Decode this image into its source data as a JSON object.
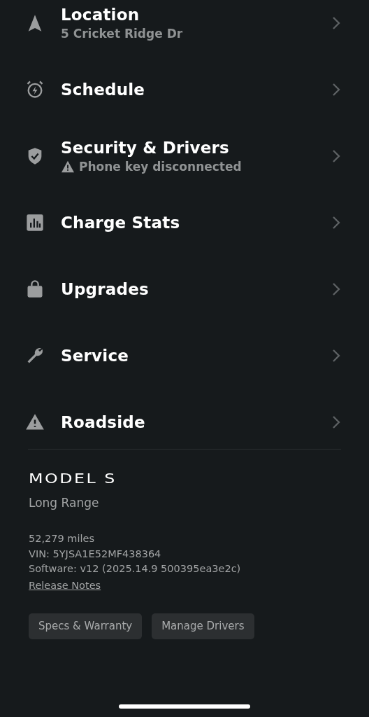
{
  "menu": [
    {
      "title": "Location",
      "subtitle": "5 Cricket Ridge Dr",
      "warning": false
    },
    {
      "title": "Schedule"
    },
    {
      "title": "Security & Drivers",
      "subtitle": "Phone key disconnected",
      "warning": true
    },
    {
      "title": "Charge Stats"
    },
    {
      "title": "Upgrades"
    },
    {
      "title": "Service"
    },
    {
      "title": "Roadside"
    }
  ],
  "vehicle": {
    "model": "MODEL S",
    "trim": "Long Range",
    "details": [
      "52,279 miles",
      "VIN: 5YJSA1E52MF438364",
      "Software: v12 (2025.14.9 500395ea3e2c)"
    ],
    "link": "Release Notes"
  },
  "buttons": [
    "Specs & Warranty",
    "Manage Drivers"
  ]
}
